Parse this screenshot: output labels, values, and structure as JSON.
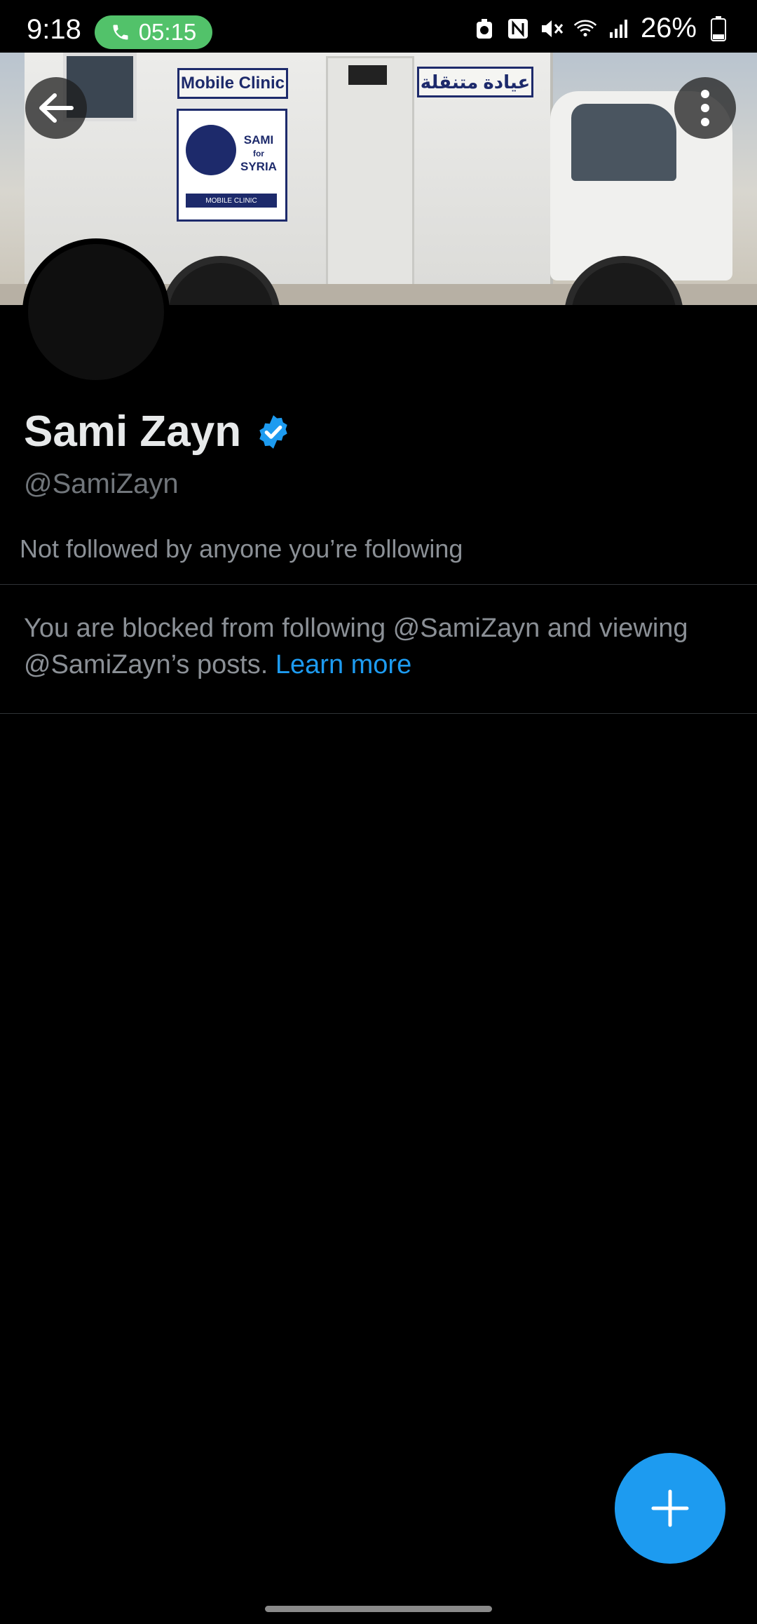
{
  "status_bar": {
    "time": "9:18",
    "call_timer": "05:15",
    "battery_percent": "26%",
    "icons": [
      "recycle-icon",
      "nfc-icon",
      "mute-icon",
      "wifi-icon",
      "signal-icon",
      "battery-icon"
    ]
  },
  "banner": {
    "sign_english": "Mobile Clinic",
    "sign_arabic": "عيادة متنقلة",
    "logo_line1": "SAMI",
    "logo_line2": "for",
    "logo_line3": "SYRIA",
    "logo_bar": "MOBILE CLINIC"
  },
  "profile": {
    "display_name": "Sami Zayn",
    "handle": "@SamiZayn",
    "followed_by": "Not followed by anyone you’re following",
    "verified": true
  },
  "blocked": {
    "message": "You are blocked from following @SamiZayn and viewing @SamiZayn’s posts. ",
    "link": "Learn more"
  },
  "colors": {
    "accent": "#1d9bf0",
    "call_pill": "#52c26a",
    "background": "#000000",
    "secondary_text": "#71767b"
  }
}
